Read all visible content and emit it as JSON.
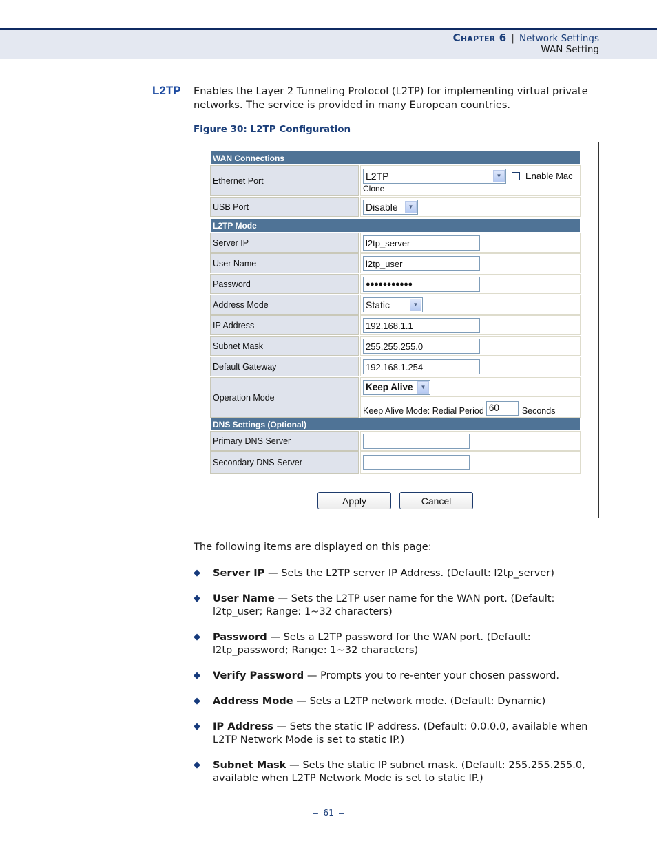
{
  "header": {
    "chapter": "Chapter 6",
    "separator": "|",
    "section": "Network Settings",
    "subsection": "WAN Setting"
  },
  "section": {
    "heading": "L2TP",
    "intro": "Enables the Layer 2 Tunneling Protocol (L2TP) for implementing virtual private networks. The service is provided in many European countries.",
    "figure_caption": "Figure 30:  L2TP Configuration"
  },
  "form": {
    "wan_connections": {
      "title": "WAN Connections",
      "ethernet_port": {
        "label": "Ethernet Port",
        "value": "L2TP",
        "checkbox_label": "Enable Mac",
        "checkbox_label_2": "Clone",
        "checked": false
      },
      "usb_port": {
        "label": "USB Port",
        "value": "Disable"
      }
    },
    "l2tp_mode": {
      "title": "L2TP Mode",
      "server_ip": {
        "label": "Server IP",
        "value": "l2tp_server"
      },
      "user_name": {
        "label": "User Name",
        "value": "l2tp_user"
      },
      "password": {
        "label": "Password",
        "value": "●●●●●●●●●●●"
      },
      "address_mode": {
        "label": "Address Mode",
        "value": "Static"
      },
      "ip_address": {
        "label": "IP Address",
        "value": "192.168.1.1"
      },
      "subnet_mask": {
        "label": "Subnet Mask",
        "value": "255.255.255.0"
      },
      "default_gateway": {
        "label": "Default Gateway",
        "value": "192.168.1.254"
      },
      "operation_mode": {
        "label": "Operation Mode",
        "value": "Keep Alive",
        "redial_label": "Keep Alive Mode: Redial Period",
        "redial_value": "60",
        "redial_unit": "Seconds"
      }
    },
    "dns": {
      "title": "DNS Settings (Optional)",
      "primary": {
        "label": "Primary DNS Server",
        "value": ""
      },
      "secondary": {
        "label": "Secondary DNS Server",
        "value": ""
      }
    },
    "buttons": {
      "apply": "Apply",
      "cancel": "Cancel"
    }
  },
  "body": {
    "list_intro": "The following items are displayed on this page:",
    "items": [
      {
        "term": "Server IP",
        "desc": " — Sets the L2TP server IP Address. (Default: l2tp_server)"
      },
      {
        "term": "User Name",
        "desc": " — Sets the L2TP user name for the WAN port. (Default: l2tp_user; Range: 1~32 characters)"
      },
      {
        "term": "Password",
        "desc": " — Sets a L2TP password for the WAN port. (Default: l2tp_password; Range: 1~32 characters)"
      },
      {
        "term": "Verify Password",
        "desc": " — Prompts you to re-enter your chosen password."
      },
      {
        "term": "Address Mode",
        "desc": " — Sets a L2TP network mode. (Default: Dynamic)"
      },
      {
        "term": "IP Address",
        "desc": " — Sets the static IP address. (Default: 0.0.0.0, available when L2TP Network Mode is set to static IP.)"
      },
      {
        "term": "Subnet Mask",
        "desc": " — Sets the static IP subnet mask. (Default: 255.255.255.0, available when L2TP Network Mode is set to static IP.)"
      }
    ]
  },
  "footer": {
    "page_number": "– 61 –"
  },
  "colors": {
    "brand_navy": "#0f2a62",
    "section_header": "#4f7396",
    "label_bg": "#dfe3ec",
    "heading_blue": "#1c4aa0"
  }
}
